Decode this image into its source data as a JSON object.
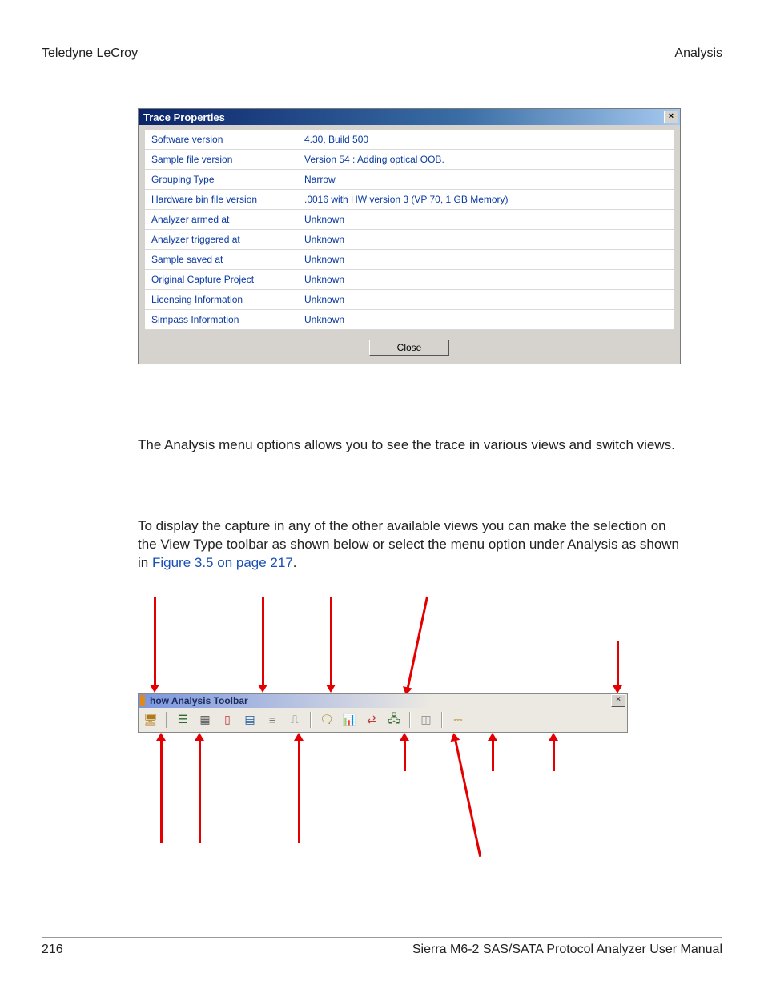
{
  "header": {
    "left": "Teledyne LeCroy",
    "right": "Analysis"
  },
  "dialog": {
    "title": "Trace Properties",
    "close_glyph": "×",
    "rows": [
      {
        "key": "Software version",
        "value": "4.30, Build 500"
      },
      {
        "key": "Sample file version",
        "value": "Version 54 : Adding optical OOB."
      },
      {
        "key": "Grouping Type",
        "value": "Narrow"
      },
      {
        "key": "Hardware bin file version",
        "value": ".0016 with HW version 3 (VP 70, 1 GB Memory)"
      },
      {
        "key": "Analyzer armed at",
        "value": "Unknown"
      },
      {
        "key": "Analyzer triggered at",
        "value": "Unknown"
      },
      {
        "key": "Sample saved at",
        "value": "Unknown"
      },
      {
        "key": "Original Capture Project",
        "value": "Unknown"
      },
      {
        "key": "Licensing Information",
        "value": "Unknown"
      },
      {
        "key": "Simpass Information",
        "value": "Unknown"
      }
    ],
    "close_button": "Close"
  },
  "paragraphs": {
    "p1": "The Analysis menu options allows you to see the trace in various views and switch views.",
    "p2a": "To display the capture in any of the other available views you can make the selection on the View Type toolbar as shown below or select the menu option under Analysis as shown in ",
    "p2_link": "Figure 3.5 on page 217",
    "p2b": "."
  },
  "toolbar": {
    "title": "how Analysis Toolbar",
    "close_glyph": "×",
    "icons": [
      {
        "name": "columns-icon",
        "glyph": "🖥",
        "color": "#b07a1a"
      },
      {
        "name": "sep"
      },
      {
        "name": "list-icon",
        "glyph": "☰",
        "color": "#2a6a2a"
      },
      {
        "name": "grid-icon",
        "glyph": "▦",
        "color": "#555"
      },
      {
        "name": "panel-icon",
        "glyph": "▯",
        "color": "#c03a3a"
      },
      {
        "name": "doc-icon",
        "glyph": "▤",
        "color": "#1a5aa0"
      },
      {
        "name": "rows-icon",
        "glyph": "≡",
        "color": "#777"
      },
      {
        "name": "wave-icon",
        "glyph": "⎍",
        "color": "#888"
      },
      {
        "name": "sep"
      },
      {
        "name": "chat-icon",
        "glyph": "🗨",
        "color": "#a07a1a"
      },
      {
        "name": "chart-icon",
        "glyph": "📊",
        "color": "#1a5aa0"
      },
      {
        "name": "flow-icon",
        "glyph": "⇄",
        "color": "#c03a3a"
      },
      {
        "name": "tree-icon",
        "glyph": "🖧",
        "color": "#2a6a2a"
      },
      {
        "name": "sep"
      },
      {
        "name": "compare-icon",
        "glyph": "◫",
        "color": "#888"
      },
      {
        "name": "sep"
      },
      {
        "name": "bus-icon",
        "glyph": "⎓",
        "color": "#b07a1a"
      }
    ]
  },
  "footer": {
    "page": "216",
    "manual": "Sierra M6-2 SAS/SATA Protocol Analyzer User Manual"
  }
}
